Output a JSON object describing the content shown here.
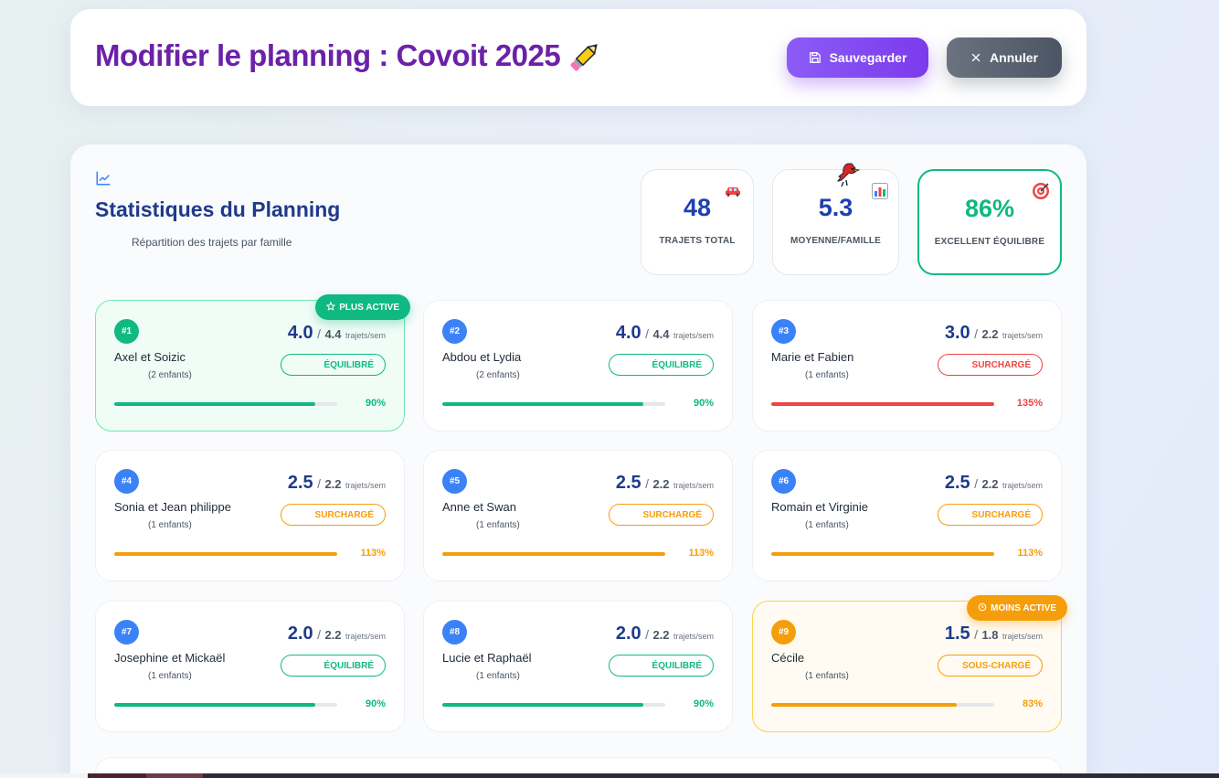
{
  "header": {
    "title": "Modifier le planning : Covoit 2025",
    "save_label": "Sauvegarder",
    "cancel_label": "Annuler"
  },
  "stats": {
    "title": "Statistiques du Planning",
    "subtitle": "Répartition des trajets par famille",
    "summary": {
      "total_value": "48",
      "total_label": "TRAJETS TOTAL",
      "avg_value": "5.3",
      "avg_label": "MOYENNE/FAMILLE",
      "balance_value": "86%",
      "balance_label": "EXCELLENT ÉQUILIBRE"
    }
  },
  "families": [
    {
      "rank": "#1",
      "name": "Axel et Soizic",
      "kids": "(2 enfants)",
      "current": "4.0",
      "sep": "/",
      "target": "4.4",
      "unit": "trajets/sem",
      "status": "ÉQUILIBRÉ",
      "percent": "90%",
      "fill": 0.9,
      "badge": "PLUS ACTIVE"
    },
    {
      "rank": "#2",
      "name": "Abdou et Lydia",
      "kids": "(2 enfants)",
      "current": "4.0",
      "sep": "/",
      "target": "4.4",
      "unit": "trajets/sem",
      "status": "ÉQUILIBRÉ",
      "percent": "90%",
      "fill": 0.9
    },
    {
      "rank": "#3",
      "name": "Marie et Fabien",
      "kids": "(1 enfants)",
      "current": "3.0",
      "sep": "/",
      "target": "2.2",
      "unit": "trajets/sem",
      "status": "SURCHARGÉ",
      "percent": "135%",
      "fill": 1.0
    },
    {
      "rank": "#4",
      "name": "Sonia et Jean philippe",
      "kids": "(1 enfants)",
      "current": "2.5",
      "sep": "/",
      "target": "2.2",
      "unit": "trajets/sem",
      "status": "SURCHARGÉ",
      "percent": "113%",
      "fill": 1.0
    },
    {
      "rank": "#5",
      "name": "Anne et Swan",
      "kids": "(1 enfants)",
      "current": "2.5",
      "sep": "/",
      "target": "2.2",
      "unit": "trajets/sem",
      "status": "SURCHARGÉ",
      "percent": "113%",
      "fill": 1.0
    },
    {
      "rank": "#6",
      "name": "Romain et Virginie",
      "kids": "(1 enfants)",
      "current": "2.5",
      "sep": "/",
      "target": "2.2",
      "unit": "trajets/sem",
      "status": "SURCHARGÉ",
      "percent": "113%",
      "fill": 1.0
    },
    {
      "rank": "#7",
      "name": "Josephine et Mickaël",
      "kids": "(1 enfants)",
      "current": "2.0",
      "sep": "/",
      "target": "2.2",
      "unit": "trajets/sem",
      "status": "ÉQUILIBRÉ",
      "percent": "90%",
      "fill": 0.9
    },
    {
      "rank": "#8",
      "name": "Lucie et Raphaël",
      "kids": "(1 enfants)",
      "current": "2.0",
      "sep": "/",
      "target": "2.2",
      "unit": "trajets/sem",
      "status": "ÉQUILIBRÉ",
      "percent": "90%",
      "fill": 0.9
    },
    {
      "rank": "#9",
      "name": "Cécile",
      "kids": "(1 enfants)",
      "current": "1.5",
      "sep": "/",
      "target": "1.8",
      "unit": "trajets/sem",
      "status": "SOUS-CHARGÉ",
      "percent": "83%",
      "fill": 0.83,
      "badge": "MOINS ACTIVE"
    }
  ],
  "colors": {
    "title_purple": "#6b21a8",
    "green": "#10b981",
    "red": "#ef4444",
    "orange": "#f59e0b",
    "blue": "#3b82f6"
  },
  "icons": {
    "title": "pencil-icon",
    "save": "floppy-disk-icon",
    "cancel": "close-icon",
    "section": "line-chart-icon",
    "total": "car-icon",
    "avg": "bar-chart-icon",
    "balance": "target-icon"
  }
}
